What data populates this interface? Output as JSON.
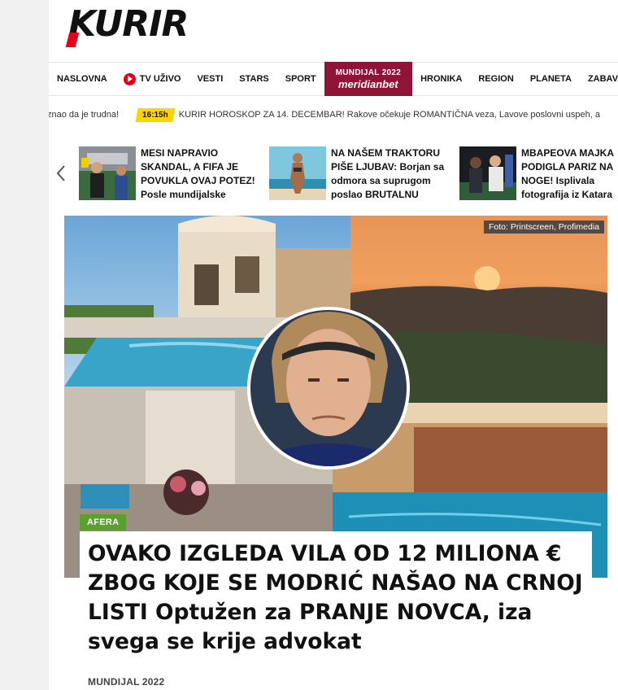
{
  "brand": {
    "logo_text": "KURIR",
    "accent": "#e3001b"
  },
  "nav": {
    "items": [
      "NASLOVNA",
      "TV UŽIVO",
      "VESTI",
      "STARS",
      "SPORT"
    ],
    "special": {
      "top": "MUNDIJAL 2022",
      "bottom": "meridianbet",
      "color": "#8f1435"
    },
    "items_after": [
      "HRONIKA",
      "REGION",
      "PLANETA",
      "ZABAVA"
    ]
  },
  "ticker": {
    "prev_text": "znao da je trudna!",
    "time": "16:15h",
    "text": "KURIR HOROSKOP ZA 14. DECEMBAR! Rakove očekuje ROMANTIČNA veza, Lavove poslovni uspeh, a"
  },
  "carousel": {
    "prev_icon": "chevron-left-icon",
    "items": [
      {
        "title": "MESI NAPRAVIO SKANDAL, A FIFA JE POVUKLA OVAJ POTEZ! Posle mundijalske"
      },
      {
        "title": "NA NAŠEM TRAKTORU PIŠE LJUBAV: Borjan sa odmora sa suprugom poslao BRUTALNU"
      },
      {
        "title": "MBAPEOVA MAJKA PODIGLA PARIZ NA NOGE! Isplivala fotografija iz Katara"
      }
    ]
  },
  "hero": {
    "credit": "Foto: Printscreen, Profimedia",
    "badge": "AFERA",
    "badge_color": "#5aa02c",
    "headline": "OVAKO IZGLEDA VILA OD 12 MILIONA € ZBOG KOJE SE MODRIĆ NAŠAO NA CRNOJ LISTI Optužen za PRANJE NOVCA, iza svega se krije advokat",
    "category": "MUNDIJAL 2022"
  }
}
